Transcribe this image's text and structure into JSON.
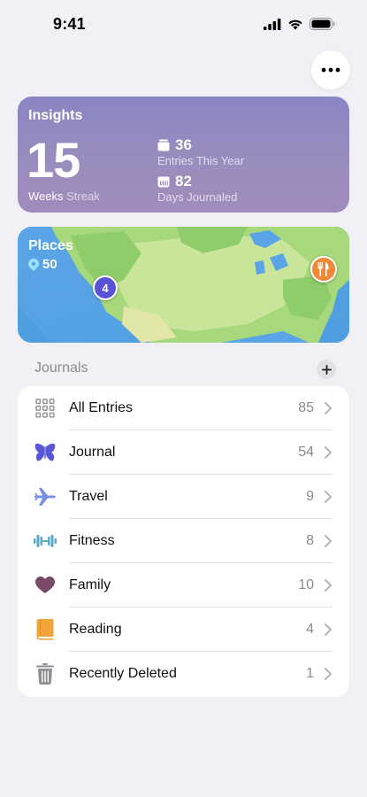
{
  "status": {
    "time": "9:41"
  },
  "insights": {
    "title": "Insights",
    "streak_value": "15",
    "streak_label_main": "Weeks",
    "streak_label_sub": "Streak",
    "entries_value": "36",
    "entries_label": "Entries This Year",
    "days_value": "82",
    "days_label": "Days Journaled"
  },
  "places": {
    "title": "Places",
    "count": "50",
    "cluster_count": "4"
  },
  "journals": {
    "header": "Journals",
    "items": [
      {
        "label": "All Entries",
        "count": "85",
        "icon": "grid-icon",
        "color": "#8e8e93"
      },
      {
        "label": "Journal",
        "count": "54",
        "icon": "butterfly-icon",
        "color": "#5856d6"
      },
      {
        "label": "Travel",
        "count": "9",
        "icon": "airplane-icon",
        "color": "#7a8fe0"
      },
      {
        "label": "Fitness",
        "count": "8",
        "icon": "dumbbell-icon",
        "color": "#5aa9c8"
      },
      {
        "label": "Family",
        "count": "10",
        "icon": "heart-icon",
        "color": "#7a4a68"
      },
      {
        "label": "Reading",
        "count": "4",
        "icon": "book-icon",
        "color": "#f2a33a"
      },
      {
        "label": "Recently Deleted",
        "count": "1",
        "icon": "trash-icon",
        "color": "#8e8e93"
      }
    ]
  }
}
